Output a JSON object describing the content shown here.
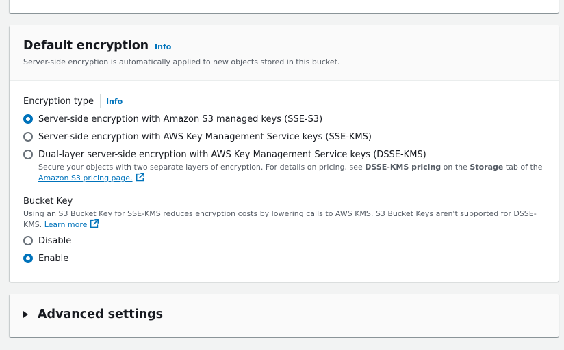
{
  "encryption": {
    "title": "Default encryption",
    "info": "Info",
    "description": "Server-side encryption is automatically applied to new objects stored in this bucket.",
    "type_label": "Encryption type",
    "type_info": "Info",
    "options": [
      {
        "label": "Server-side encryption with Amazon S3 managed keys (SSE-S3)",
        "checked": true
      },
      {
        "label": "Server-side encryption with AWS Key Management Service keys (SSE-KMS)",
        "checked": false
      },
      {
        "label": "Dual-layer server-side encryption with AWS Key Management Service keys (DSSE-KMS)",
        "checked": false
      }
    ],
    "dsse_desc_pre": "Secure your objects with two separate layers of encryption. For details on pricing, see ",
    "dsse_desc_bold1": "DSSE-KMS pricing",
    "dsse_desc_mid": " on the ",
    "dsse_desc_bold2": "Storage",
    "dsse_desc_post": " tab of the ",
    "dsse_link": "Amazon S3 pricing page."
  },
  "bucket_key": {
    "label": "Bucket Key",
    "description": "Using an S3 Bucket Key for SSE-KMS reduces encryption costs by lowering calls to AWS KMS. S3 Bucket Keys aren't supported for DSSE-KMS. ",
    "learn_more": "Learn more",
    "options": [
      {
        "label": "Disable",
        "checked": false
      },
      {
        "label": "Enable",
        "checked": true
      }
    ]
  },
  "advanced": {
    "title": "Advanced settings"
  },
  "colors": {
    "accent": "#0073bb",
    "background": "#f2f3f3",
    "text": "#16191f",
    "muted": "#545b64"
  },
  "icons": {
    "external_link": "external-link-icon",
    "expand": "caret-right-icon"
  }
}
